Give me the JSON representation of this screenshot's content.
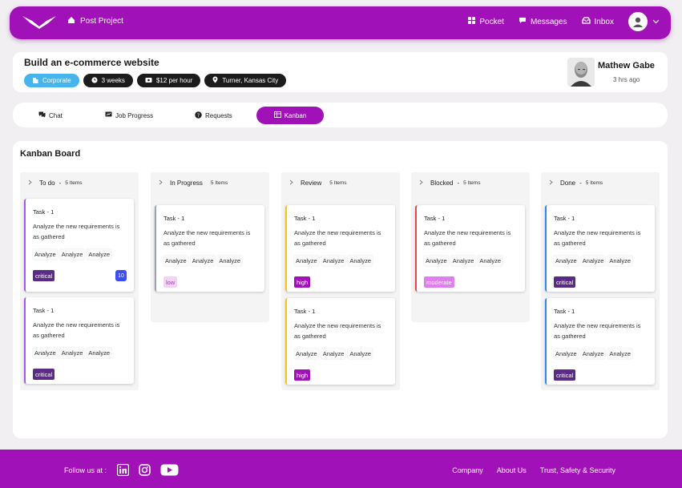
{
  "nav": {
    "post_project": "Post Project",
    "links": [
      {
        "label": "Pocket",
        "icon": "grid-icon"
      },
      {
        "label": "Messages",
        "icon": "chat-bubble-icon"
      },
      {
        "label": "Inbox",
        "icon": "inbox-icon"
      }
    ]
  },
  "project": {
    "title": "Build an e-commerce website",
    "chips": [
      "Corporate",
      "3 weeks",
      "$12 per hour",
      "Turner, Kansas City"
    ],
    "owner_name": "Mathew Gabe",
    "posted": "3 hrs ago"
  },
  "tabs": [
    {
      "label": "Chat",
      "icon": "chat-icon",
      "active": false
    },
    {
      "label": "Job Progress",
      "icon": "progress-icon",
      "active": false
    },
    {
      "label": "Requests",
      "icon": "question-icon",
      "active": false
    },
    {
      "label": "Kanban",
      "icon": "table-icon",
      "active": true
    }
  ],
  "board": {
    "title": "Kanban Board",
    "columns": [
      {
        "name": "To do",
        "suffix": "-",
        "count_label": "5 Items",
        "cards": [
          {
            "title": "Task - 1",
            "desc": "Analyze the new requirements is as gathered",
            "tags": [
              "Analyze",
              "Analyze",
              "Analyze"
            ],
            "priority": "critical",
            "count": "10",
            "accent": "#a855f7"
          },
          {
            "title": "Task - 1",
            "desc": "Analyze the new requirements is as gathered",
            "tags": [
              "Analyze",
              "Analyze",
              "Analyze"
            ],
            "priority": "critical",
            "accent": "#a855f7"
          }
        ]
      },
      {
        "name": "In Progress",
        "suffix": "",
        "count_label": "5 Items",
        "cards": [
          {
            "title": "Task - 1",
            "desc": "Analyze the new requirements is as gathered",
            "tags": [
              "Analyze",
              "Analyze",
              "Analyze"
            ],
            "priority": "low",
            "accent": "#9ca3af"
          }
        ]
      },
      {
        "name": "Review",
        "suffix": "",
        "count_label": "5 Items",
        "cards": [
          {
            "title": "Task - 1",
            "desc": "Analyze the new requirements is as gathered",
            "tags": [
              "Analyze",
              "Analyze",
              "Analyze"
            ],
            "priority": "high",
            "accent": "#f5c518"
          },
          {
            "title": "Task - 1",
            "desc": "Analyze the new requirements is as gathered",
            "tags": [
              "Analyze",
              "Analyze",
              "Analyze"
            ],
            "priority": "high",
            "accent": "#f5c518"
          }
        ]
      },
      {
        "name": "Blocked",
        "suffix": "-",
        "count_label": "5 Items",
        "cards": [
          {
            "title": "Task - 1",
            "desc": "Analyze the new requirements is as gathered",
            "tags": [
              "Analyze",
              "Analyze",
              "Analyze"
            ],
            "priority": "moderate",
            "accent": "#ef4444"
          }
        ]
      },
      {
        "name": "Done",
        "suffix": "-",
        "count_label": "5 Items",
        "cards": [
          {
            "title": "Task - 1",
            "desc": "Analyze the new requirements is as gathered",
            "tags": [
              "Analyze",
              "Analyze",
              "Analyze"
            ],
            "priority": "critical",
            "accent": "#3b82f6"
          },
          {
            "title": "Task - 1",
            "desc": "Analyze the new requirements is as gathered",
            "tags": [
              "Analyze",
              "Analyze",
              "Analyze"
            ],
            "priority": "critical",
            "accent": "#3b82f6"
          }
        ]
      }
    ]
  },
  "priority_colors": {
    "critical": {
      "bg": "#5b2a86",
      "fg": "#ffffff"
    },
    "low": {
      "bg": "#f3d4f7",
      "fg": "#a13fb2"
    },
    "high": {
      "bg": "#a012b8",
      "fg": "#ffffff"
    },
    "moderate": {
      "bg": "#e07ef0",
      "fg": "#ffffff"
    }
  },
  "footer": {
    "follow": "Follow us at :",
    "socials": [
      "linkedin-icon",
      "instagram-icon",
      "youtube-icon"
    ],
    "links": [
      "Company",
      "About Us",
      "Trust, Safety & Security"
    ]
  }
}
